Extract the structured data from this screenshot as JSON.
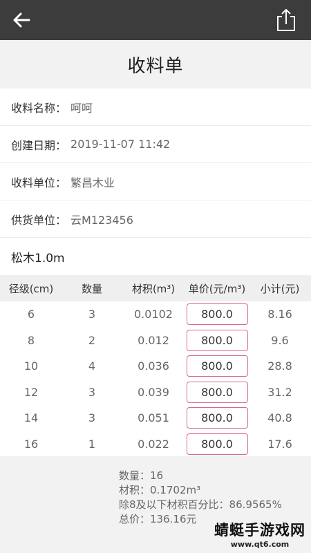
{
  "header": {
    "back_icon": "back-arrow-icon",
    "share_icon": "share-icon"
  },
  "title": "收料单",
  "info": [
    {
      "label": "收料名称：",
      "value": "呵呵"
    },
    {
      "label": "创建日期：",
      "value": "2019-11-07 11:42"
    },
    {
      "label": "收料单位：",
      "value": "繁昌木业"
    },
    {
      "label": "供货单位：",
      "value": "云M123456"
    }
  ],
  "product": "松木1.0m",
  "table": {
    "headers": [
      "径级(cm)",
      "数量",
      "材积(m³)",
      "单价(元/m³)",
      "小计(元)"
    ],
    "rows": [
      {
        "diameter": "6",
        "qty": "3",
        "volume": "0.0102",
        "price": "800.0",
        "subtotal": "8.16"
      },
      {
        "diameter": "8",
        "qty": "2",
        "volume": "0.012",
        "price": "800.0",
        "subtotal": "9.6"
      },
      {
        "diameter": "10",
        "qty": "4",
        "volume": "0.036",
        "price": "800.0",
        "subtotal": "28.8"
      },
      {
        "diameter": "12",
        "qty": "3",
        "volume": "0.039",
        "price": "800.0",
        "subtotal": "31.2"
      },
      {
        "diameter": "14",
        "qty": "3",
        "volume": "0.051",
        "price": "800.0",
        "subtotal": "40.8"
      },
      {
        "diameter": "16",
        "qty": "1",
        "volume": "0.022",
        "price": "800.0",
        "subtotal": "17.6"
      }
    ]
  },
  "summary": {
    "count": "数量：16",
    "volume": "材积：0.1702m³",
    "percent": "除8及以下材积百分比：86.9565%",
    "total": "总价：136.16元"
  },
  "watermark": {
    "main": "蜻蜓手游戏网",
    "sub": "www.qt6.com"
  },
  "colors": {
    "topbar": "#3c3c3c",
    "price_border": "#d36a92"
  }
}
